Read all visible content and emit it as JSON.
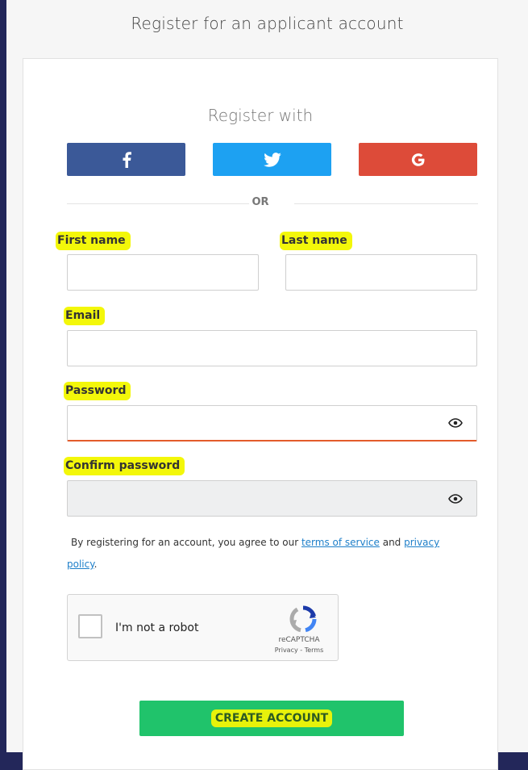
{
  "page": {
    "title": "Register for an applicant account"
  },
  "social": {
    "heading": "Register with",
    "facebook_icon": "facebook-icon",
    "twitter_icon": "twitter-icon",
    "google_icon": "google-icon",
    "divider": "OR",
    "colors": {
      "facebook": "#3b5998",
      "twitter": "#1da1f2",
      "google": "#dd4b39"
    }
  },
  "form": {
    "first_name": {
      "label": "First name",
      "value": "",
      "placeholder": ""
    },
    "last_name": {
      "label": "Last name",
      "value": "",
      "placeholder": ""
    },
    "email": {
      "label": "Email",
      "value": "",
      "placeholder": ""
    },
    "password": {
      "label": "Password",
      "value": "",
      "placeholder": ""
    },
    "confirm_password": {
      "label": "Confirm password",
      "value": "",
      "placeholder": ""
    }
  },
  "terms": {
    "prefix": "By registering for an account, you agree to our ",
    "tos_link": "terms of service",
    "middle": " and ",
    "privacy_link": "privacy policy",
    "suffix": "."
  },
  "captcha": {
    "label": "I'm not a robot",
    "brand": "reCAPTCHA",
    "links": "Privacy - Terms"
  },
  "submit": {
    "label": "CREATE ACCOUNT",
    "color": "#20c36b"
  }
}
